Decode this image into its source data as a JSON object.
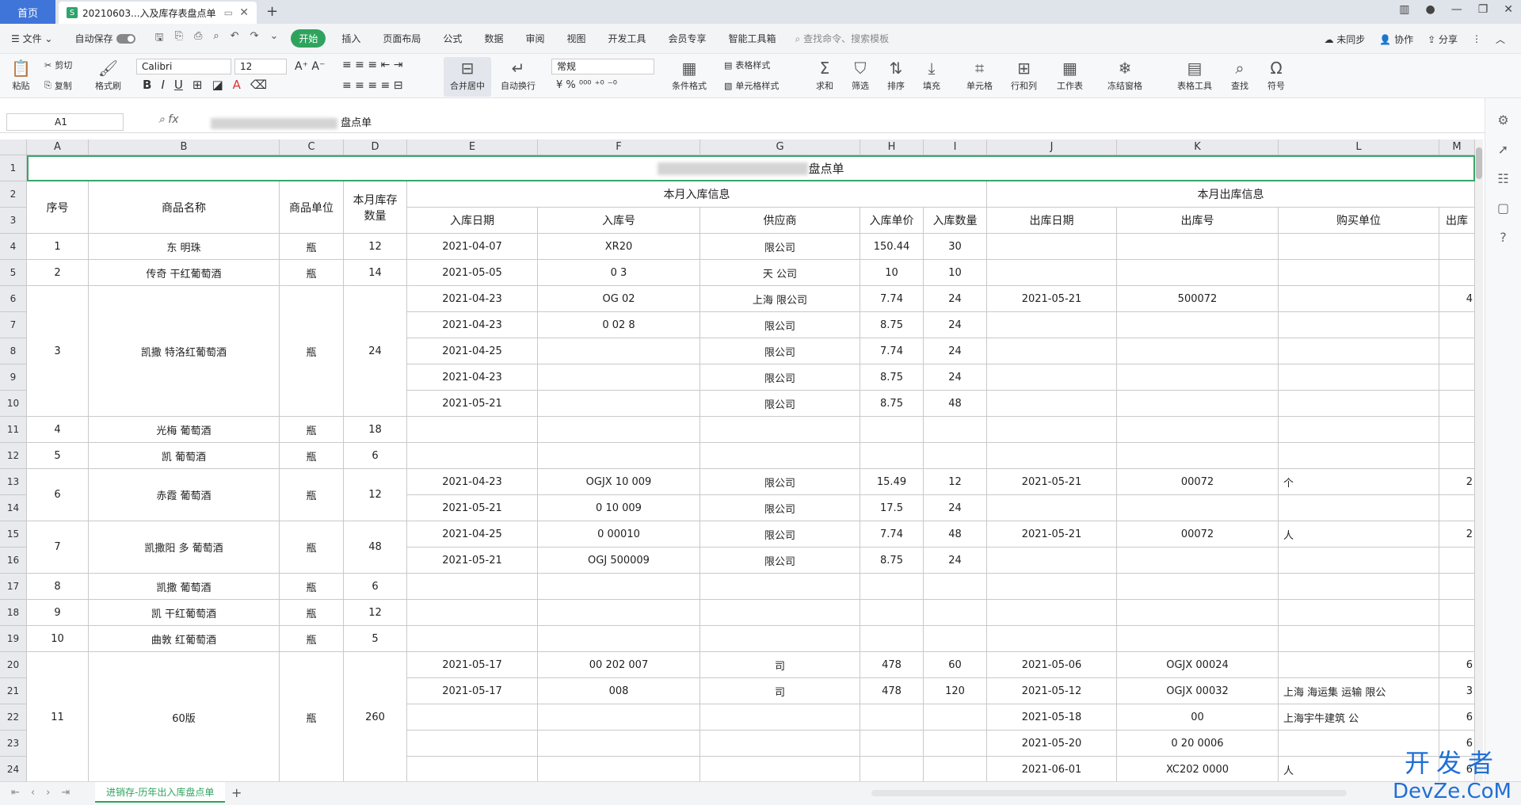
{
  "tabs": {
    "home": "首页",
    "doc_title": "20210603...入及库存表盘点单",
    "doc_icon": "S"
  },
  "menu": {
    "file": "文件",
    "autosave": "自动保存",
    "items": [
      "开始",
      "插入",
      "页面布局",
      "公式",
      "数据",
      "审阅",
      "视图",
      "开发工具",
      "会员专享",
      "智能工具箱"
    ],
    "search": "查找命令、搜索模板",
    "right": [
      "未同步",
      "协作",
      "分享"
    ]
  },
  "ribbon": {
    "paste": "粘贴",
    "cut": "剪切",
    "copy": "复制",
    "format_painter": "格式刷",
    "font_name": "Calibri",
    "font_size": "12",
    "merge": "合并居中",
    "wrap": "自动换行",
    "number_format": "常规",
    "cond_format": "条件格式",
    "table_style": "表格样式",
    "cell_style": "单元格样式",
    "sum": "求和",
    "filter": "筛选",
    "sort": "排序",
    "fill": "填充",
    "cells": "单元格",
    "rowcol": "行和列",
    "sheet": "工作表",
    "freeze": "冻结窗格",
    "table_tools": "表格工具",
    "find": "查找",
    "symbol": "符号"
  },
  "formula": {
    "namebox": "A1",
    "content": "盘点单"
  },
  "columns": [
    "A",
    "B",
    "C",
    "D",
    "E",
    "F",
    "G",
    "H",
    "I",
    "J",
    "K",
    "L",
    "M"
  ],
  "rows": [
    "1",
    "2",
    "3",
    "4",
    "5",
    "6",
    "7",
    "8",
    "9",
    "10",
    "11",
    "12",
    "13",
    "14",
    "15",
    "16",
    "17",
    "18",
    "19",
    "20",
    "21",
    "22",
    "23",
    "24"
  ],
  "sheet": {
    "title_suffix": "盘点单",
    "headers": {
      "seq": "序号",
      "name": "商品名称",
      "unit": "商品单位",
      "stock": "本月库存数量",
      "in_group": "本月入库信息",
      "out_group": "本月出库信息",
      "in_date": "入库日期",
      "in_no": "入库号",
      "supplier": "供应商",
      "in_price": "入库单价",
      "in_qty": "入库数量",
      "out_date": "出库日期",
      "out_no": "出库号",
      "buyer": "购买单位",
      "out_more": "出库"
    },
    "products": [
      {
        "seq": "1",
        "name": "东   明珠",
        "unit": "瓶",
        "stock": "12"
      },
      {
        "seq": "2",
        "name": "传奇            干红葡萄酒",
        "unit": "瓶",
        "stock": "14"
      },
      {
        "seq": "3",
        "name": "凯撒       特洛红葡萄酒",
        "unit": "瓶",
        "stock": "24"
      },
      {
        "seq": "4",
        "name": "光梅       葡萄酒",
        "unit": "瓶",
        "stock": "18"
      },
      {
        "seq": "5",
        "name": "凯       葡萄酒",
        "unit": "瓶",
        "stock": "6"
      },
      {
        "seq": "6",
        "name": "赤霞      葡萄酒",
        "unit": "瓶",
        "stock": "12"
      },
      {
        "seq": "7",
        "name": "凯撒阳      多    葡萄酒",
        "unit": "瓶",
        "stock": "48"
      },
      {
        "seq": "8",
        "name": "凯撒          葡萄酒",
        "unit": "瓶",
        "stock": "6"
      },
      {
        "seq": "9",
        "name": "凯        干红葡萄酒",
        "unit": "瓶",
        "stock": "12"
      },
      {
        "seq": "10",
        "name": "曲敦      红葡萄酒",
        "unit": "瓶",
        "stock": "5"
      },
      {
        "seq": "11",
        "name": "     60版",
        "unit": "瓶",
        "stock": "260"
      }
    ],
    "lines": [
      {
        "row": 4,
        "in_date": "2021-04-07",
        "in_no": "XR20",
        "supplier": "限公司",
        "price": "150.44",
        "qty": "30",
        "out_date": "",
        "out_no": "",
        "buyer": "",
        "out_more": ""
      },
      {
        "row": 5,
        "in_date": "2021-05-05",
        "in_no": "0      3",
        "supplier": "天         公司",
        "price": "10",
        "qty": "10",
        "out_date": "",
        "out_no": "",
        "buyer": "",
        "out_more": ""
      },
      {
        "row": 6,
        "in_date": "2021-04-23",
        "in_no": "OG     02",
        "supplier": "上海        限公司",
        "price": "7.74",
        "qty": "24",
        "out_date": "2021-05-21",
        "out_no": "500072",
        "buyer": "",
        "out_more": "4"
      },
      {
        "row": 7,
        "in_date": "2021-04-23",
        "in_no": "0      02     8",
        "supplier": "限公司",
        "price": "8.75",
        "qty": "24",
        "out_date": "",
        "out_no": "",
        "buyer": "",
        "out_more": ""
      },
      {
        "row": 8,
        "in_date": "2021-04-25",
        "in_no": "",
        "supplier": "限公司",
        "price": "7.74",
        "qty": "24",
        "out_date": "",
        "out_no": "",
        "buyer": "",
        "out_more": ""
      },
      {
        "row": 9,
        "in_date": "2021-04-23",
        "in_no": "",
        "supplier": "限公司",
        "price": "8.75",
        "qty": "24",
        "out_date": "",
        "out_no": "",
        "buyer": "",
        "out_more": ""
      },
      {
        "row": 10,
        "in_date": "2021-05-21",
        "in_no": "",
        "supplier": "限公司",
        "price": "8.75",
        "qty": "48",
        "out_date": "",
        "out_no": "",
        "buyer": "",
        "out_more": ""
      },
      {
        "row": 13,
        "in_date": "2021-04-23",
        "in_no": "OGJX   10   009",
        "supplier": "限公司",
        "price": "15.49",
        "qty": "12",
        "out_date": "2021-05-21",
        "out_no": "00072",
        "buyer": "个",
        "out_more": "2"
      },
      {
        "row": 14,
        "in_date": "2021-05-21",
        "in_no": "0      10   009",
        "supplier": "限公司",
        "price": "17.5",
        "qty": "24",
        "out_date": "",
        "out_no": "",
        "buyer": "",
        "out_more": ""
      },
      {
        "row": 15,
        "in_date": "2021-04-25",
        "in_no": "0         00010",
        "supplier": "限公司",
        "price": "7.74",
        "qty": "48",
        "out_date": "2021-05-21",
        "out_no": "00072",
        "buyer": "人",
        "out_more": "2"
      },
      {
        "row": 16,
        "in_date": "2021-05-21",
        "in_no": "OGJ     500009",
        "supplier": "限公司",
        "price": "8.75",
        "qty": "24",
        "out_date": "",
        "out_no": "",
        "buyer": "",
        "out_more": ""
      },
      {
        "row": 20,
        "in_date": "2021-05-17",
        "in_no": "00   202     007",
        "supplier": "司",
        "price": "478",
        "qty": "60",
        "out_date": "2021-05-06",
        "out_no": "OGJX    00024",
        "buyer": "",
        "out_more": "6"
      },
      {
        "row": 21,
        "in_date": "2021-05-17",
        "in_no": "008",
        "supplier": "司",
        "price": "478",
        "qty": "120",
        "out_date": "2021-05-12",
        "out_no": "OGJX    00032",
        "buyer": "上海     海运集    运输   限公",
        "out_more": "3"
      },
      {
        "row": 22,
        "in_date": "",
        "in_no": "",
        "supplier": "",
        "price": "",
        "qty": "",
        "out_date": "2021-05-18",
        "out_no": "00",
        "buyer": "上海宇牛建筑      公",
        "out_more": "6"
      },
      {
        "row": 23,
        "in_date": "",
        "in_no": "",
        "supplier": "",
        "price": "",
        "qty": "",
        "out_date": "2021-05-20",
        "out_no": "0    20   0006",
        "buyer": "",
        "out_more": "6"
      },
      {
        "row": 24,
        "in_date": "",
        "in_no": "",
        "supplier": "",
        "price": "",
        "qty": "",
        "out_date": "2021-06-01",
        "out_no": "XC202   0000",
        "buyer": "人",
        "out_more": "6"
      }
    ]
  },
  "sheet_tab": "进销存-历年出入库盘点单",
  "watermark": {
    "line1": "开发者",
    "line2": "DevZe.CoM"
  }
}
